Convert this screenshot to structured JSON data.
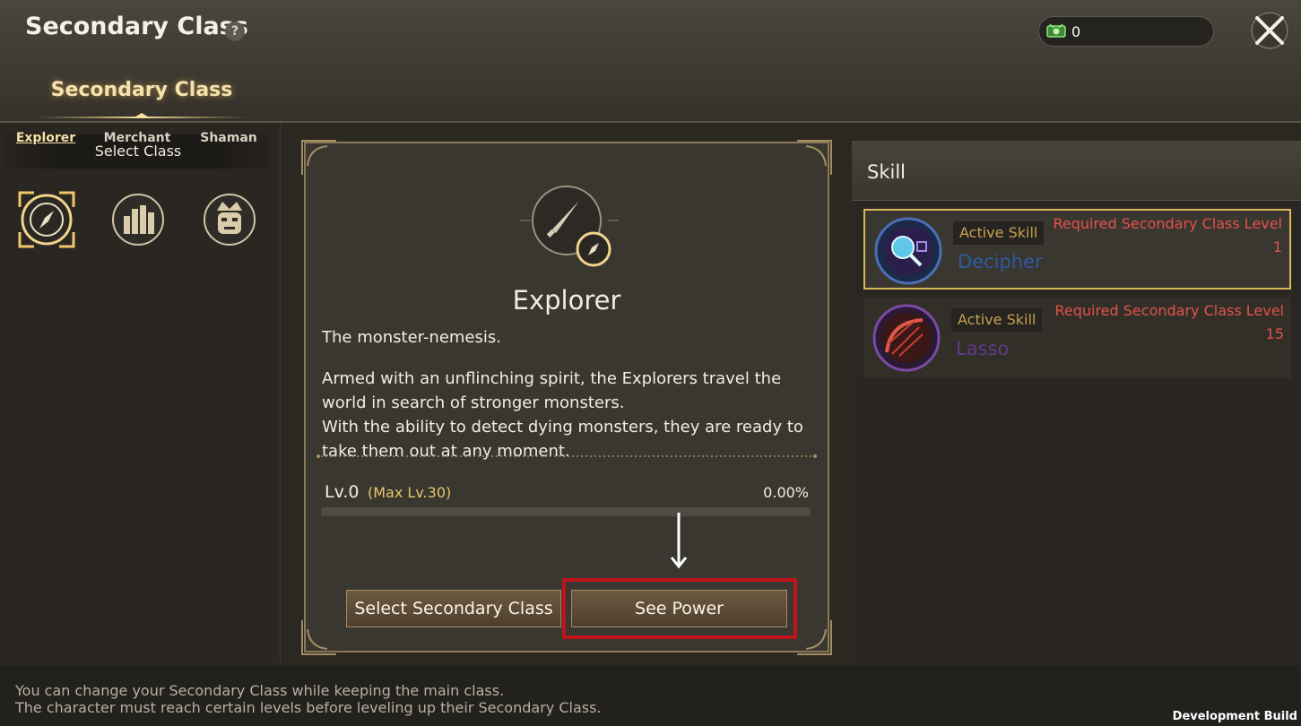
{
  "header": {
    "title": "Secondary Class",
    "help": "?",
    "currency_value": "0",
    "tab_label": "Secondary Class"
  },
  "left": {
    "select_header": "Select Class",
    "classes": [
      {
        "label": "Explorer",
        "icon": "compass-icon",
        "selected": true
      },
      {
        "label": "Merchant",
        "icon": "coins-icon",
        "selected": false
      },
      {
        "label": "Shaman",
        "icon": "mask-icon",
        "selected": false
      }
    ]
  },
  "detail": {
    "icon": "dagger-compass-icon",
    "name": "Explorer",
    "tagline": "The monster-nemesis.",
    "desc1": "Armed with an unflinching spirit, the Explorers travel the world in search of stronger monsters.",
    "desc2": "With the ability to detect dying monsters, they are ready to take them out at any moment.",
    "level": "Lv.0",
    "max_level": "(Max Lv.30)",
    "progress_text": "0.00%",
    "progress": 0,
    "btn_select": "Select Secondary Class",
    "btn_power": "See Power"
  },
  "skills": {
    "header": "Skill",
    "items": [
      {
        "type": "Active Skill",
        "name": "Decipher",
        "req_label": "Required Secondary Class Level",
        "req_level": "1",
        "name_color": "#2f5a9e",
        "icon": "magnifier-icon"
      },
      {
        "type": "Active Skill",
        "name": "Lasso",
        "req_label": "Required Secondary Class Level",
        "req_level": "15",
        "name_color": "#5e3b86",
        "icon": "lasso-icon"
      }
    ]
  },
  "footer": {
    "line1": "You can change your Secondary Class while keeping the main class.",
    "line2": "The character must reach certain levels before leveling up their Secondary Class.",
    "dev_build": "Development Build"
  },
  "colors": {
    "accent_gold": "#e8c46a",
    "required_red": "#e2534a",
    "highlight_red": "#c0141a"
  }
}
